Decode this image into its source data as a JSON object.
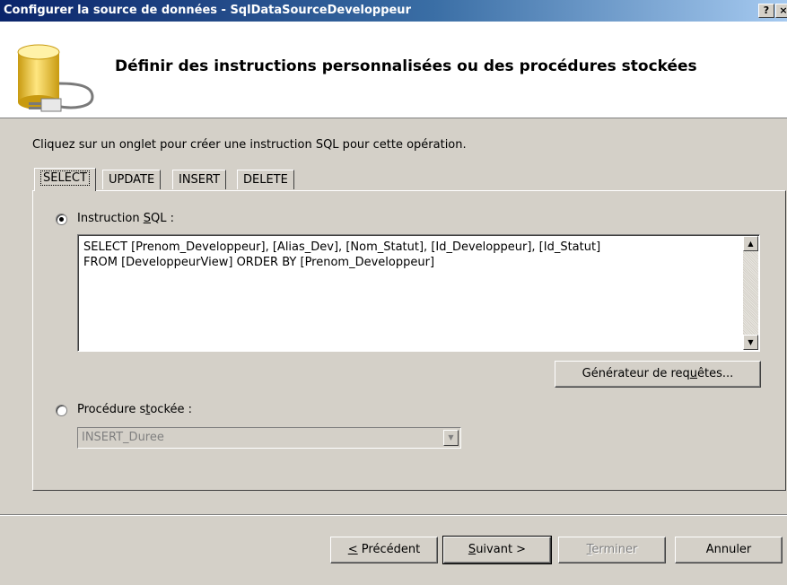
{
  "window": {
    "title": "Configurer la source de données - SqlDataSourceDeveloppeur",
    "help_label": "?",
    "close_label": "×"
  },
  "header": {
    "title": "Définir des instructions personnalisées ou des procédures stockées"
  },
  "instruction": "Cliquez sur un onglet pour créer une instruction SQL pour cette opération.",
  "tabs": [
    {
      "label": "SELECT",
      "active": true
    },
    {
      "label": "UPDATE",
      "active": false
    },
    {
      "label": "INSERT",
      "active": false
    },
    {
      "label": "DELETE",
      "active": false
    }
  ],
  "sql_option": {
    "label_pre": "Instruction ",
    "label_mn": "S",
    "label_post": "QL :",
    "checked": true,
    "value": "SELECT [Prenom_Developpeur], [Alias_Dev], [Nom_Statut], [Id_Developpeur], [Id_Statut]\nFROM [DeveloppeurView] ORDER BY [Prenom_Developpeur]"
  },
  "query_builder": {
    "label_pre": "Générateur de req",
    "label_mn": "u",
    "label_post": "êtes..."
  },
  "proc_option": {
    "label_pre": "Procédure s",
    "label_mn": "t",
    "label_post": "ockée :",
    "checked": false,
    "selected": "INSERT_Duree"
  },
  "footer": {
    "prev_mn": "<",
    "prev_rest": " Précédent",
    "next_mn": "S",
    "next_rest": "uivant >",
    "finish_mn": "T",
    "finish_rest": "erminer",
    "cancel": "Annuler"
  },
  "colors": {
    "titlebar_start": "#0a246a",
    "titlebar_end": "#a6caf0",
    "dialog_bg": "#d4d0c8"
  }
}
